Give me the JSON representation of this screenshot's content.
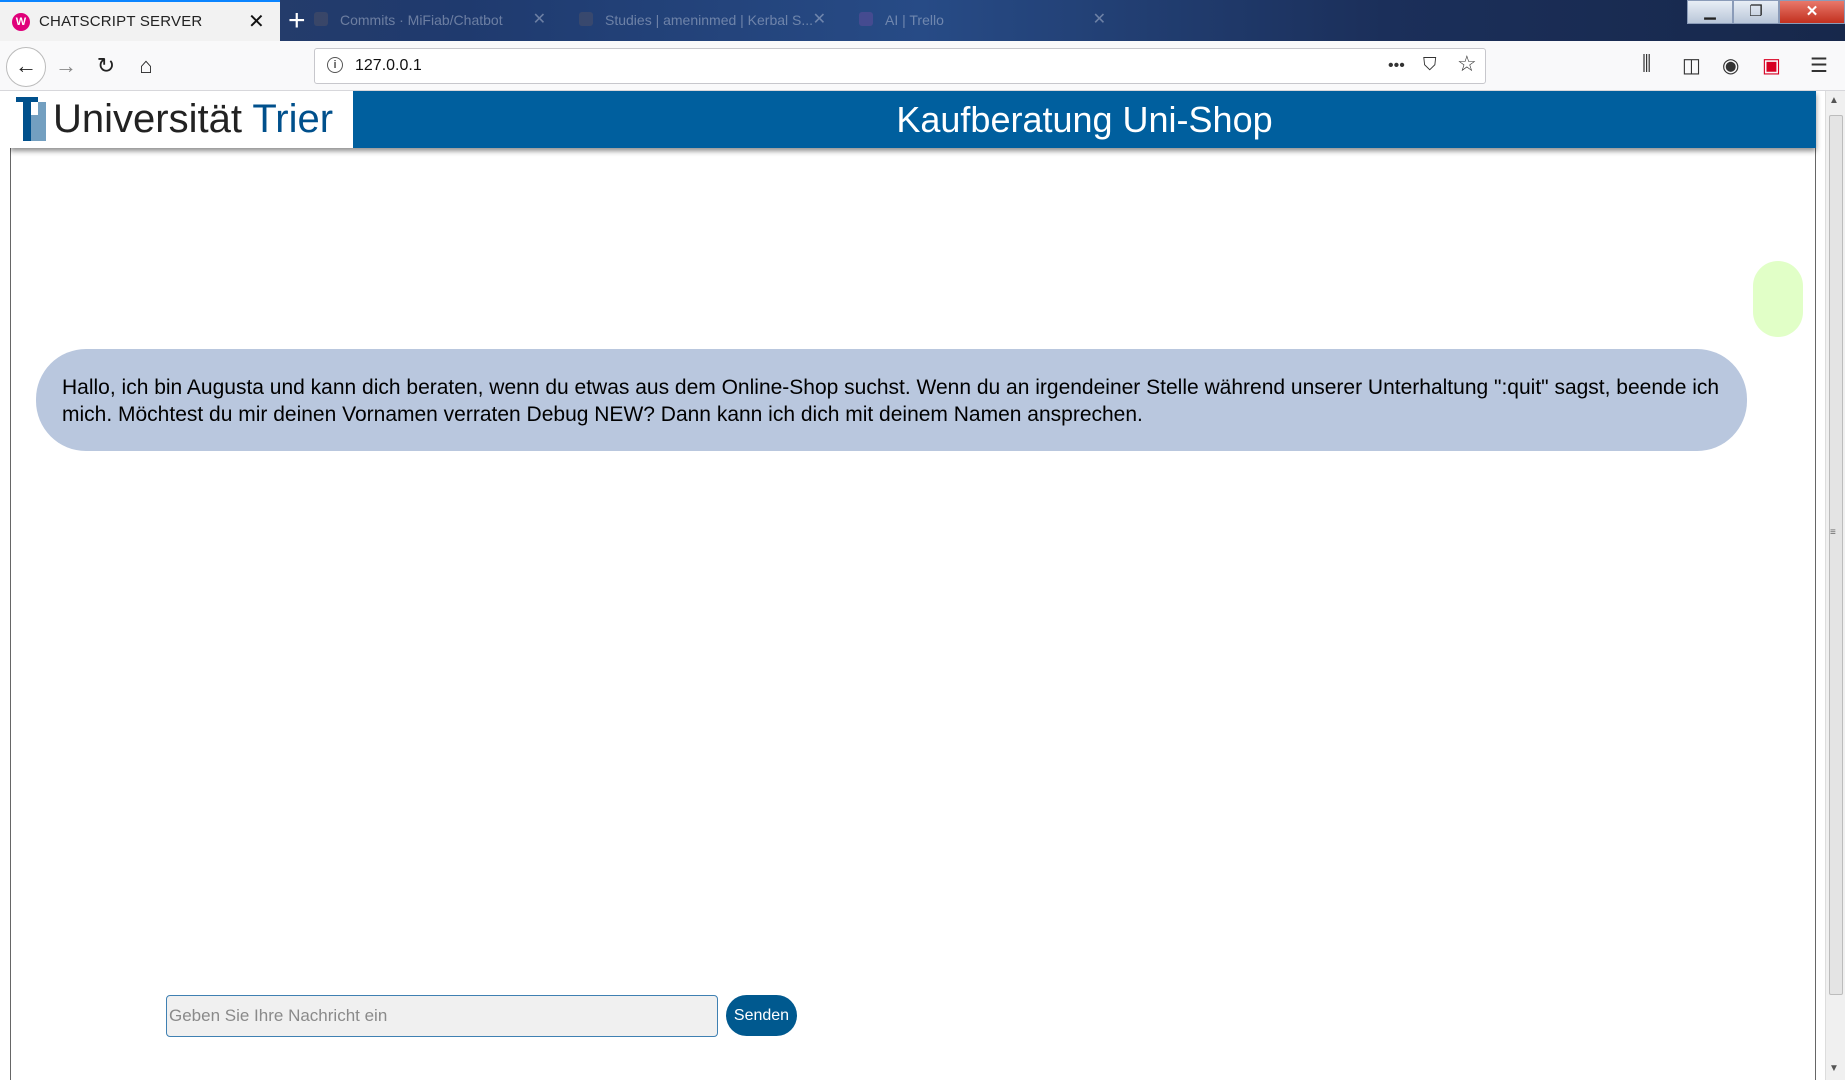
{
  "browser": {
    "active_tab": {
      "title": "CHATSCRIPT SERVER",
      "favicon": "W"
    },
    "background_tabs": [
      {
        "title": "Commits · MiFiab/Chatbot"
      },
      {
        "title": "Studies | ameninmed | Kerbal S..."
      },
      {
        "title": "AI | Trello"
      }
    ],
    "new_tab_label": "+",
    "window_controls": {
      "minimize": "▁",
      "maximize": "❐",
      "close": "✕"
    },
    "nav": {
      "back": "←",
      "forward": "→",
      "reload": "↻",
      "home": "⌂"
    },
    "url": "127.0.0.1",
    "url_actions": {
      "more": "•••",
      "pocket": "⛉",
      "bookmark": "☆"
    },
    "toolbar_icons": {
      "library": "⫼",
      "sidebar": "◫",
      "account": "◉",
      "extension": "▣",
      "menu": "☰"
    }
  },
  "page": {
    "logo": {
      "word1": "Universität",
      "word2": "Trier"
    },
    "header_title": "Kaufberatung Uni-Shop",
    "bot_message": "Hallo, ich bin Augusta und kann dich beraten, wenn du etwas aus dem Online-Shop suchst. Wenn du an irgendeiner Stelle während unserer Unterhaltung \":quit\" sagst, beende ich mich. Möchtest du mir deinen Vornamen verraten Debug NEW? Dann kann ich dich mit deinem Namen ansprechen.",
    "user_message": "",
    "input_placeholder": "Geben Sie Ihre Nachricht ein",
    "send_label": "Senden",
    "colors": {
      "header_bg": "#005f9e",
      "bot_bubble": "#b9c7de",
      "user_bubble": "#e1ffc7",
      "send_button": "#00598f"
    }
  },
  "scrollbar": {
    "up": "▲",
    "down": "▼",
    "grip": "≡"
  }
}
